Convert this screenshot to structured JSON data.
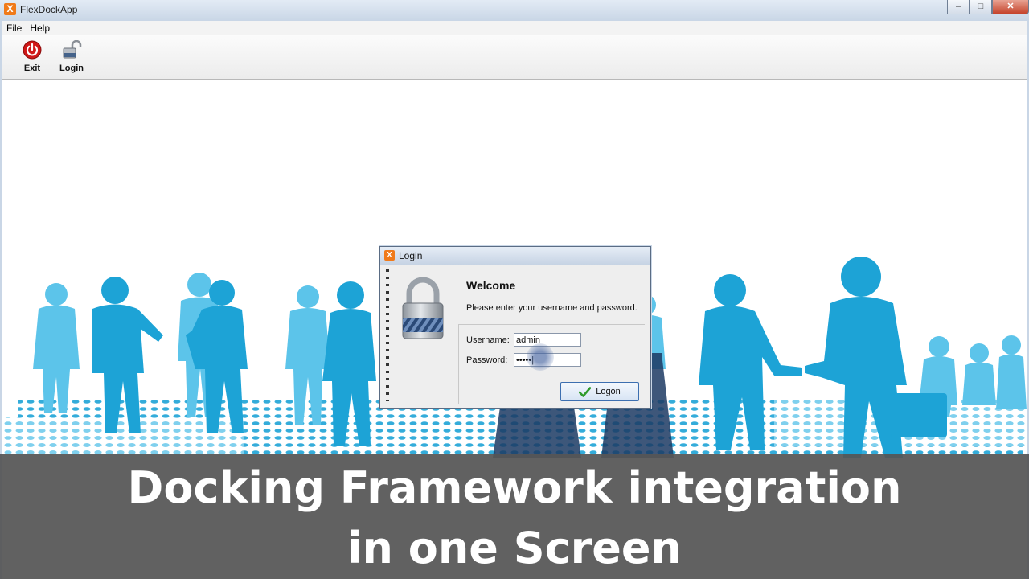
{
  "window": {
    "title": "FlexDockApp",
    "buttons": [
      "‒",
      "□",
      "✕"
    ]
  },
  "menu": {
    "items": [
      "File",
      "Help"
    ]
  },
  "toolbar": {
    "exit_label": "Exit",
    "login_label": "Login"
  },
  "dialog": {
    "title": "Login",
    "welcome": "Welcome",
    "instruction": "Please enter your username and password.",
    "username_label": "Username:",
    "username_value": "admin",
    "password_label": "Password:",
    "password_value": "•••••|",
    "logon_label": "Logon"
  },
  "caption": {
    "line1": "Docking Framework integration",
    "line2": "in one Screen"
  },
  "colors": {
    "silhouette": "#1da3d6",
    "silhouette_light": "#5cc4ea",
    "accent_orange": "#f07a1a",
    "caption_bg": "#555555"
  }
}
